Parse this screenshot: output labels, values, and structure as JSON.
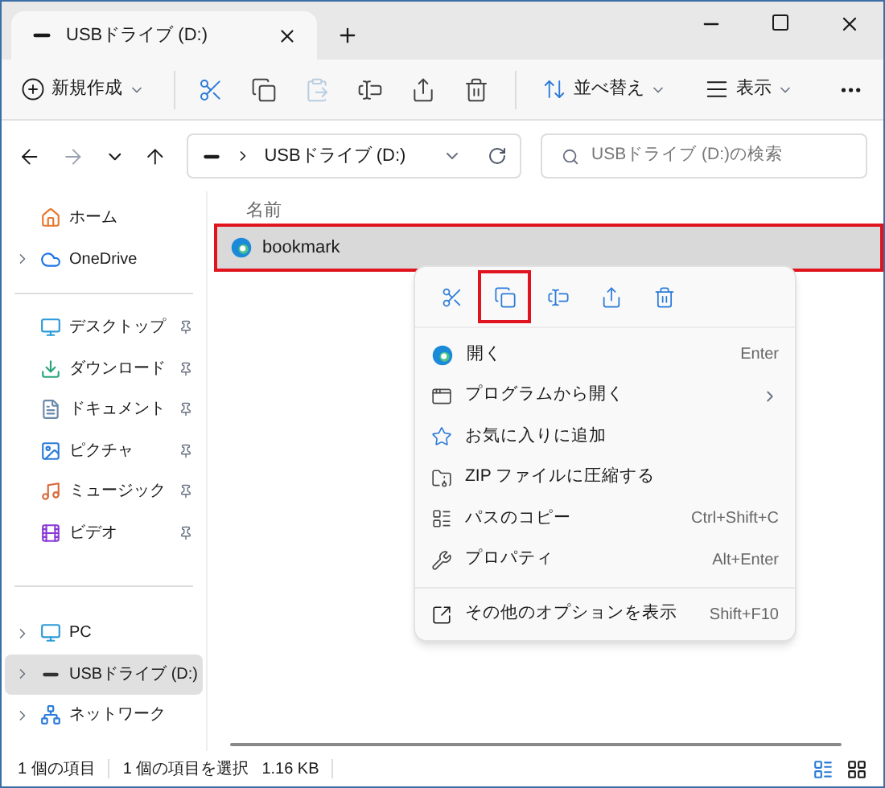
{
  "tab": {
    "title": "USBドライブ (D:)"
  },
  "toolbar": {
    "new_label": "新規作成",
    "icon_buttons": [
      {
        "disabled": false
      },
      {
        "disabled": false
      },
      {
        "disabled": true
      },
      {
        "disabled": false
      },
      {
        "disabled": false
      },
      {
        "disabled": false
      }
    ],
    "sort_label": "並べ替え",
    "view_label": "表示"
  },
  "address": {
    "path": "USBドライブ (D:)",
    "search_placeholder": "USBドライブ (D:)の検索"
  },
  "sidebar": {
    "groups": [
      [
        {
          "label": "ホーム",
          "expandable": false,
          "pinned": false,
          "selected": false
        },
        {
          "label": "OneDrive",
          "expandable": true,
          "pinned": false,
          "selected": false
        }
      ],
      [
        {
          "label": "デスクトップ",
          "expandable": false,
          "pinned": true,
          "selected": false
        },
        {
          "label": "ダウンロード",
          "expandable": false,
          "pinned": true,
          "selected": false
        },
        {
          "label": "ドキュメント",
          "expandable": false,
          "pinned": true,
          "selected": false
        },
        {
          "label": "ピクチャ",
          "expandable": false,
          "pinned": true,
          "selected": false
        },
        {
          "label": "ミュージック",
          "expandable": false,
          "pinned": true,
          "selected": false
        },
        {
          "label": "ビデオ",
          "expandable": false,
          "pinned": true,
          "selected": false
        }
      ],
      [
        {
          "label": "PC",
          "expandable": true,
          "pinned": false,
          "selected": false
        },
        {
          "label": "USBドライブ (D:)",
          "expandable": true,
          "pinned": false,
          "selected": true
        },
        {
          "label": "ネットワーク",
          "expandable": true,
          "pinned": false,
          "selected": false
        }
      ]
    ]
  },
  "column_header": "名前",
  "files": [
    {
      "name": "bookmark",
      "selected": true,
      "highlighted": true
    }
  ],
  "context_menu": {
    "actions": [
      {
        "highlighted": false
      },
      {
        "highlighted": true
      },
      {
        "highlighted": false
      },
      {
        "highlighted": false
      },
      {
        "highlighted": false
      }
    ],
    "items": [
      {
        "label": "開く",
        "shortcut": "Enter",
        "submenu": false
      },
      {
        "label": "プログラムから開く",
        "submenu": true
      },
      {
        "label": "お気に入りに追加",
        "submenu": false
      },
      {
        "label": "ZIP ファイルに圧縮する",
        "submenu": false
      },
      {
        "label": "パスのコピー",
        "shortcut": "Ctrl+Shift+C",
        "submenu": false
      },
      {
        "label": "プロパティ",
        "shortcut": "Alt+Enter",
        "submenu": false
      }
    ],
    "more": {
      "label": "その他のオプションを表示",
      "shortcut": "Shift+F10"
    }
  },
  "status_bar": {
    "count": "1 個の項目",
    "selection": "1 個の項目を選択",
    "size": "1.16 KB"
  }
}
